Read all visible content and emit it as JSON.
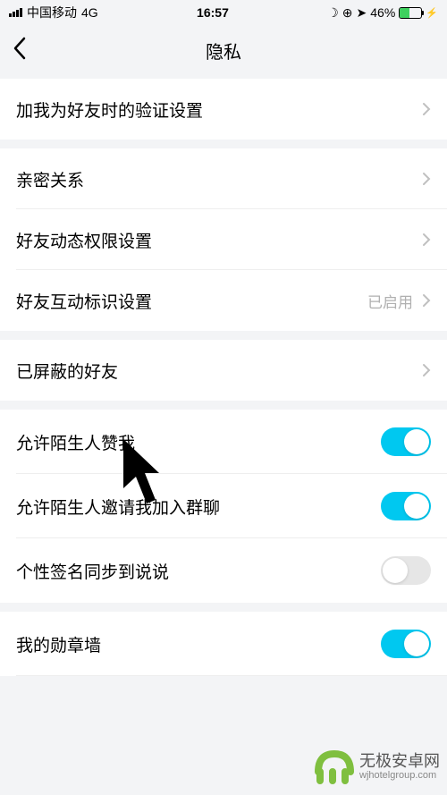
{
  "status": {
    "carrier": "中国移动",
    "network": "4G",
    "time": "16:57",
    "moon_icon": "☽",
    "lock_icon": "⊕",
    "location_icon": "➤",
    "battery_text": "46%",
    "charge_icon": "⚡"
  },
  "header": {
    "title": "隐私"
  },
  "rows": {
    "friend_verify": "加我为好友时的验证设置",
    "intimate": "亲密关系",
    "feed_permission": "好友动态权限设置",
    "interaction_badge": "好友互动标识设置",
    "interaction_badge_value": "已启用",
    "blocked_friends": "已屏蔽的好友",
    "stranger_like": "允许陌生人赞我",
    "stranger_group": "允许陌生人邀请我加入群聊",
    "sig_sync": "个性签名同步到说说",
    "medal_wall": "我的勋章墙"
  },
  "toggles": {
    "stranger_like": true,
    "stranger_group": true,
    "sig_sync": false,
    "medal_wall": true
  },
  "watermark": {
    "text": "无极安卓网",
    "url": "wjhotelgroup.com"
  }
}
